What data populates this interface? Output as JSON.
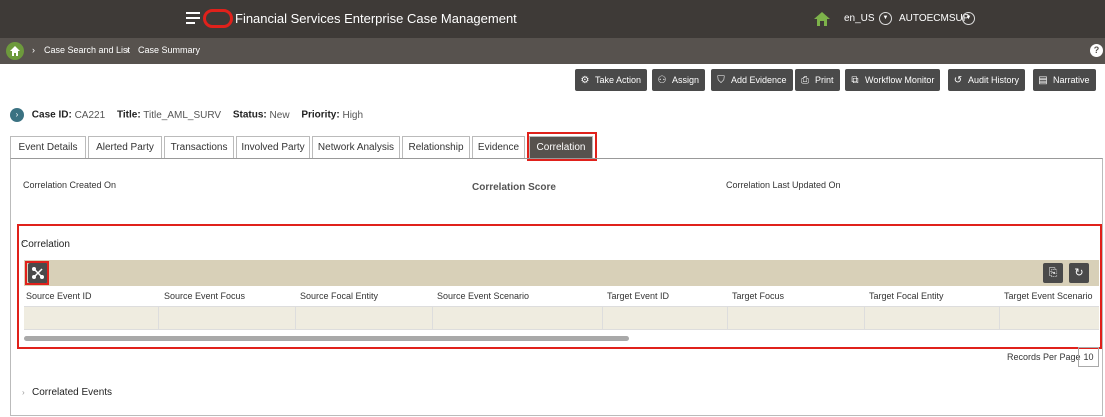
{
  "header": {
    "app_title": "Financial Services Enterprise Case Management",
    "locale": "en_US",
    "user": "AUTOECMSUP"
  },
  "breadcrumb": {
    "items": [
      "Case Search and List",
      "Case Summary"
    ],
    "help": "?"
  },
  "actions": [
    {
      "label": "Take Action",
      "icon": "take-action-icon"
    },
    {
      "label": "Assign",
      "icon": "assign-icon"
    },
    {
      "label": "Add Evidence",
      "icon": "evidence-icon"
    },
    {
      "label": "Print",
      "icon": "print-icon"
    },
    {
      "label": "Workflow Monitor",
      "icon": "workflow-icon"
    },
    {
      "label": "Audit History",
      "icon": "history-icon"
    },
    {
      "label": "Narrative",
      "icon": "narrative-icon"
    }
  ],
  "case": {
    "id_label": "Case ID:",
    "id": "CA221",
    "title_label": "Title:",
    "title": "Title_AML_SURV",
    "status_label": "Status:",
    "status": "New",
    "priority_label": "Priority:",
    "priority": "High"
  },
  "tabs": [
    {
      "label": "Event Details"
    },
    {
      "label": "Alerted Party"
    },
    {
      "label": "Transactions"
    },
    {
      "label": "Involved Party"
    },
    {
      "label": "Network Analysis"
    },
    {
      "label": "Relationship"
    },
    {
      "label": "Evidence"
    },
    {
      "label": "Correlation",
      "active": true
    }
  ],
  "summary": {
    "created_on": "Correlation Created On",
    "score": "Correlation Score",
    "last_updated": "Correlation Last Updated On"
  },
  "correlation_section": {
    "title": "Correlation",
    "columns": [
      "Source Event ID",
      "Source Event Focus",
      "Source Focal Entity",
      "Source Event Scenario",
      "Target Event ID",
      "Target Focus",
      "Target Focal Entity",
      "Target Event Scenario"
    ],
    "rows": []
  },
  "pagination": {
    "records_per_page_label": "Records Per Page",
    "records_per_page": "10"
  },
  "correlated_events": {
    "title": "Correlated Events"
  },
  "colors": {
    "topbar": "#3e3a37",
    "breadbar": "#57524e",
    "toolbar": "#d8d0b8",
    "highlight": "#e0211b",
    "home_green": "#6d9a3c"
  }
}
